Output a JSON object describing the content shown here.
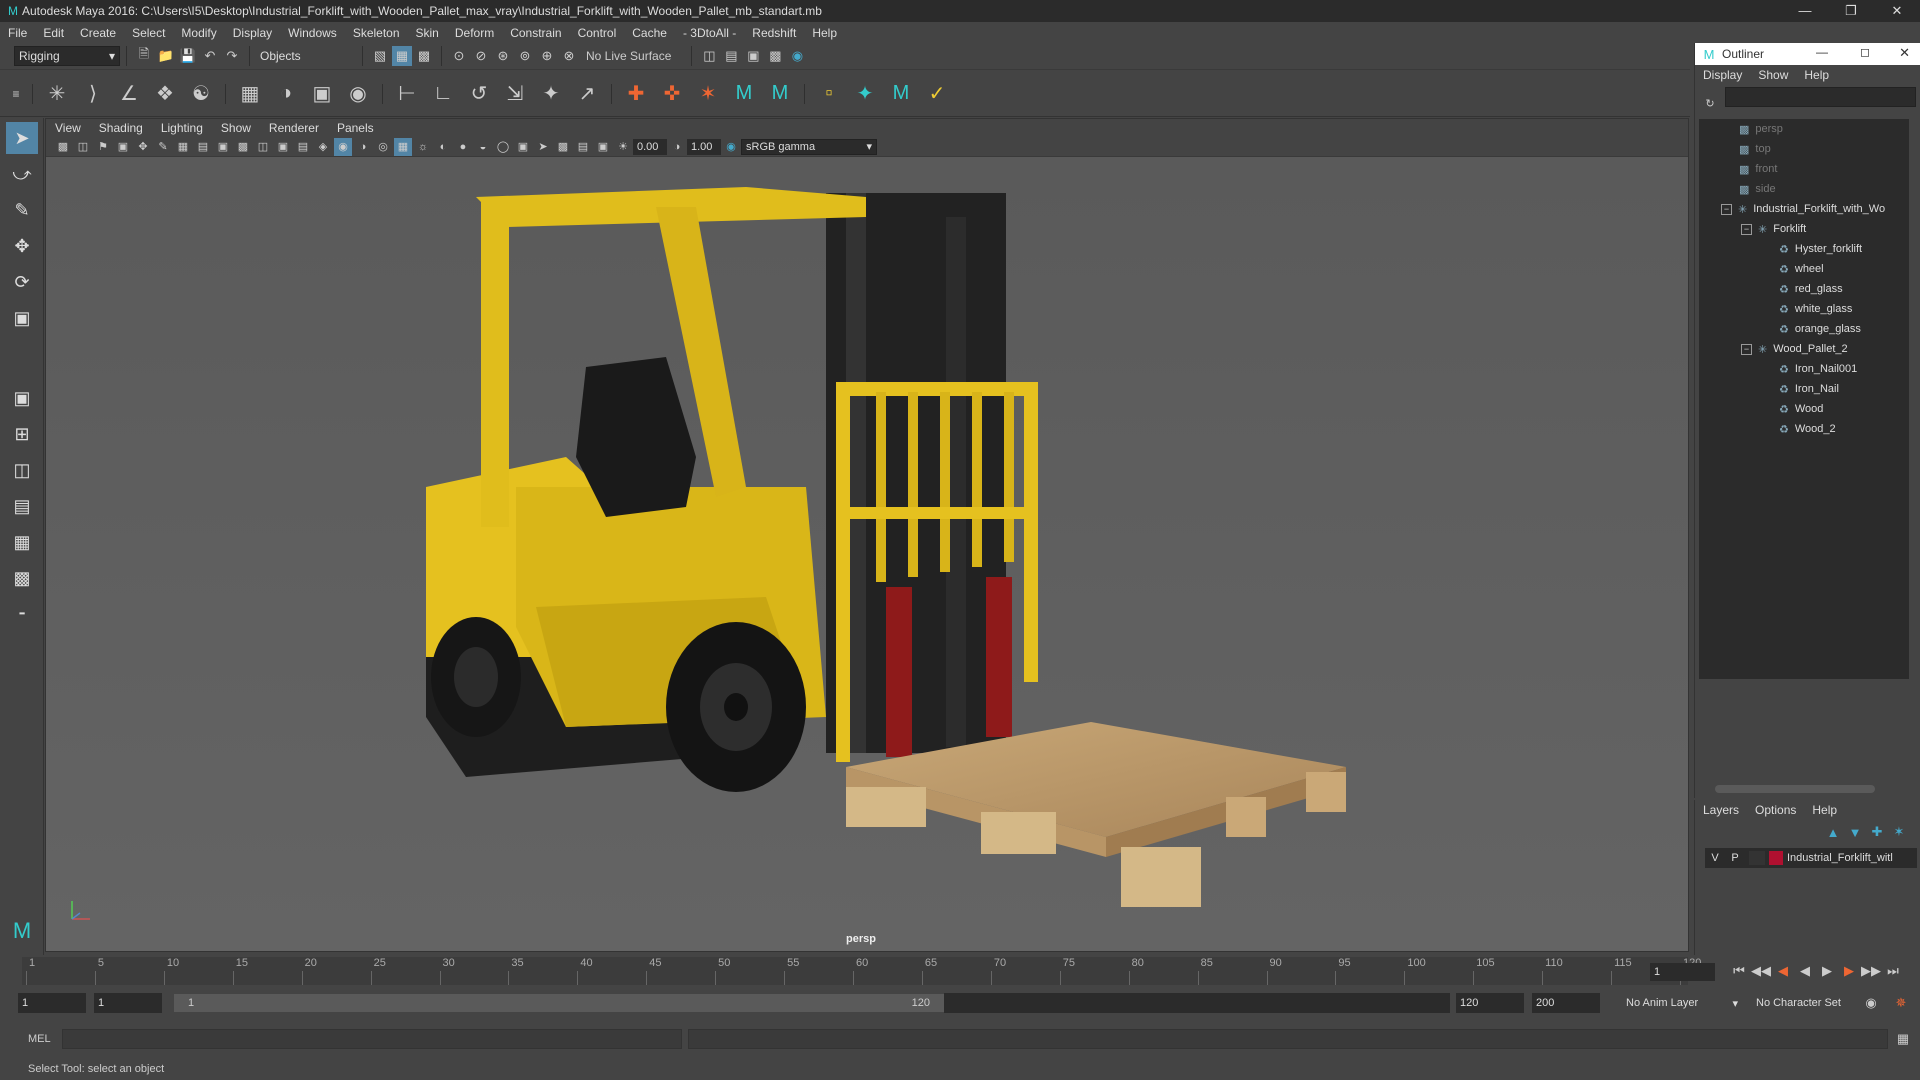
{
  "window": {
    "title": "Autodesk Maya 2016: C:\\Users\\I5\\Desktop\\Industrial_Forklift_with_Wooden_Pallet_max_vray\\Industrial_Forklift_with_Wooden_Pallet_mb_standart.mb"
  },
  "menus": [
    "File",
    "Edit",
    "Create",
    "Select",
    "Modify",
    "Display",
    "Windows",
    "Skeleton",
    "Skin",
    "Deform",
    "Constrain",
    "Control",
    "Cache",
    "- 3DtoAll -",
    "Redshift",
    "Help"
  ],
  "statusline": {
    "mode": "Rigging",
    "objects": "Objects",
    "live_surface": "No Live Surface"
  },
  "viewport": {
    "menu": [
      "View",
      "Shading",
      "Lighting",
      "Show",
      "Renderer",
      "Panels"
    ],
    "exposure": "0.00",
    "gamma": "1.00",
    "colorspace": "sRGB gamma",
    "camera": "persp"
  },
  "outliner": {
    "title": "Outliner",
    "menu": [
      "Display",
      "Show",
      "Help"
    ],
    "nodes": [
      {
        "label": "persp"
      },
      {
        "label": "top"
      },
      {
        "label": "front"
      },
      {
        "label": "side"
      },
      {
        "label": "Industrial_Forklift_with_Wo"
      },
      {
        "label": "Forklift"
      },
      {
        "label": "Hyster_forklift"
      },
      {
        "label": "wheel"
      },
      {
        "label": "red_glass"
      },
      {
        "label": "white_glass"
      },
      {
        "label": "orange_glass"
      },
      {
        "label": "Wood_Pallet_2"
      },
      {
        "label": "Iron_Nail001"
      },
      {
        "label": "Iron_Nail"
      },
      {
        "label": "Wood"
      },
      {
        "label": "Wood_2"
      }
    ]
  },
  "layers": {
    "menu": [
      "Layers",
      "Options",
      "Help"
    ],
    "row": {
      "v": "V",
      "p": "P",
      "name": "Industrial_Forklift_witl"
    },
    "layer_color": "#b01030"
  },
  "timeline": {
    "ticks": [
      "1",
      "5",
      "10",
      "15",
      "20",
      "25",
      "30",
      "35",
      "40",
      "45",
      "50",
      "55",
      "60",
      "65",
      "70",
      "75",
      "80",
      "85",
      "90",
      "95",
      "100",
      "105",
      "110",
      "115",
      "120"
    ],
    "current_frame": "1"
  },
  "range": {
    "start": "1",
    "start2": "1",
    "slider_start": "1",
    "slider_end": "120",
    "end": "120",
    "max": "200",
    "anim_layer": "No Anim Layer",
    "char_set": "No Character Set"
  },
  "cmd": {
    "label": "MEL"
  },
  "help": {
    "text": "Select Tool: select an object"
  }
}
